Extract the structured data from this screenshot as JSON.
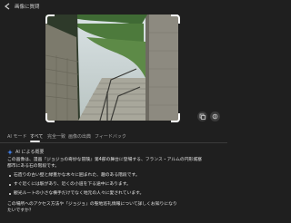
{
  "search": {
    "value": "画像に質問"
  },
  "tabs": [
    {
      "label": "AI モード"
    },
    {
      "label": "すべて"
    },
    {
      "label": "完全一致"
    },
    {
      "label": "画像の出典"
    },
    {
      "label": "フィードバック"
    }
  ],
  "ai_overview": {
    "label": "AI による概要",
    "intro_line1": "この画像は、漫画『ジョジョの奇妙な冒険』第4部の舞台に登場する、フランス・アルムの円形城塞",
    "intro_line2": "都市にある石の階段です。",
    "bullets": [
      {
        "text": "石造りの古い壁と緑豊かな木々に囲まれた、趣のある階段です。"
      },
      {
        "text": "すぐ近くには駅があり、近くの小道を下る途中にあります。"
      },
      {
        "text": "観光ルートの小さな横手だけでなく地元の人々に愛されています。"
      }
    ],
    "question_line1": "この場所へのアクセス方法や『ジョジョ』の聖地巡礼情報について詳しくお知りになり",
    "question_line2": "たいですか？"
  },
  "colors": {
    "background": "#1f1f1f",
    "text": "#e3e3e3",
    "ai_icon": "#4285f4"
  },
  "icons": [
    "back-arrow-icon",
    "copy-icon",
    "share-icon",
    "sparkle-icon"
  ]
}
